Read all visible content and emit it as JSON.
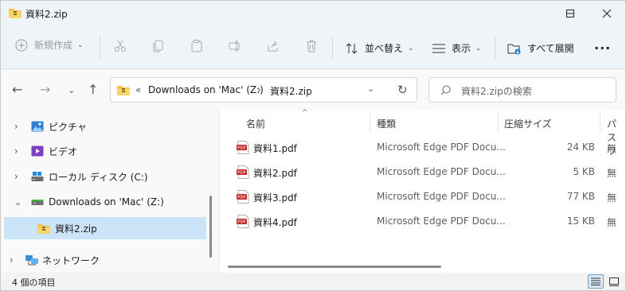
{
  "window": {
    "title": "資料2.zip",
    "minimize_icon": "minimize-icon",
    "maximize_icon": "maximize-icon",
    "close_icon": "close-icon"
  },
  "toolbar": {
    "new_label": "新規作成",
    "sort_label": "並べ替え",
    "view_label": "表示",
    "expand_all_label": "すべて展開",
    "more_label": "..."
  },
  "address": {
    "prefix": "«",
    "segments": [
      "Downloads on 'Mac' (Z:)",
      "資料2.zip"
    ],
    "separator": "›"
  },
  "search": {
    "placeholder": "資料2.zipの検索"
  },
  "sidebar": {
    "items": [
      {
        "label": "ピクチャ",
        "icon": "pictures-icon",
        "chevron": "›"
      },
      {
        "label": "ビデオ",
        "icon": "videos-icon",
        "chevron": "›"
      },
      {
        "label": "ローカル ディスク (C:)",
        "icon": "disk-icon",
        "chevron": "›"
      },
      {
        "label": "Downloads on 'Mac' (Z:)",
        "icon": "network-drive-icon",
        "chevron": "⌄"
      },
      {
        "label": "資料2.zip",
        "icon": "zip-folder-icon",
        "chevron": ""
      },
      {
        "label": "ネットワーク",
        "icon": "network-icon",
        "chevron": "›"
      }
    ]
  },
  "list": {
    "columns": [
      "名前",
      "種類",
      "圧縮サイズ",
      "パスワ"
    ],
    "rows": [
      {
        "name": "資料1.pdf",
        "type": "Microsoft Edge PDF Docu...",
        "size": "24 KB",
        "password": "無"
      },
      {
        "name": "資料2.pdf",
        "type": "Microsoft Edge PDF Docu...",
        "size": "5 KB",
        "password": "無"
      },
      {
        "name": "資料3.pdf",
        "type": "Microsoft Edge PDF Docu...",
        "size": "77 KB",
        "password": "無"
      },
      {
        "name": "資料4.pdf",
        "type": "Microsoft Edge PDF Docu...",
        "size": "15 KB",
        "password": "無"
      }
    ],
    "pdf_badge": "PDF"
  },
  "status": {
    "item_count": "4 個の項目"
  },
  "colors": {
    "accent": "#cce4f7",
    "folder": "#f2c14e",
    "pdf": "#c62828"
  }
}
